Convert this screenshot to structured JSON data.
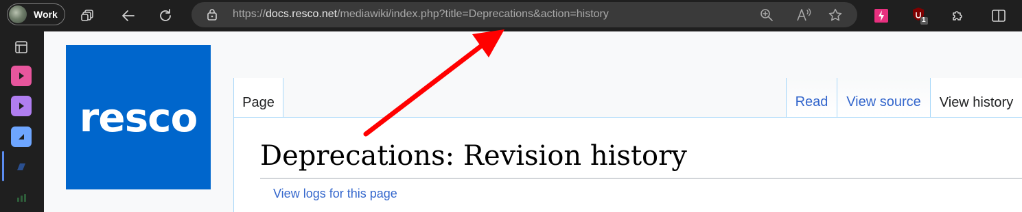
{
  "browser": {
    "profile_label": "Work",
    "url_protocol": "https://",
    "url_host": "docs.resco.net",
    "url_path": "/mediawiki/index.php?title=Deprecations&action=history",
    "extension_badge": "1"
  },
  "logo": {
    "text": "resco"
  },
  "tabs": {
    "page": "Page",
    "read": "Read",
    "view_source": "View source",
    "view_history": "View history"
  },
  "page": {
    "heading": "Deprecations: Revision history",
    "logs_link": "View logs for this page"
  },
  "colors": {
    "logo_bg": "#0066cc",
    "link": "#3366cc",
    "tab_border": "#a7d7f9",
    "annotation_arrow": "#ff0000"
  }
}
